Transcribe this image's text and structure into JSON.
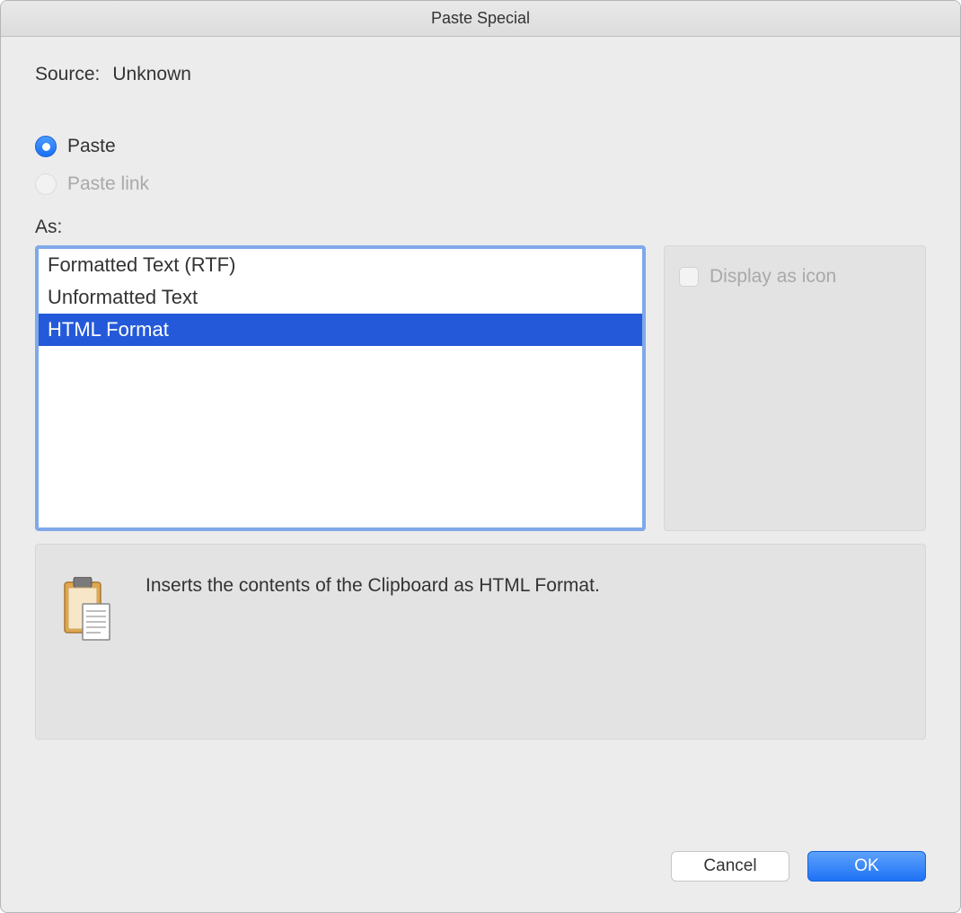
{
  "title": "Paste Special",
  "source": {
    "label": "Source:",
    "value": "Unknown"
  },
  "radios": {
    "paste": {
      "label": "Paste",
      "selected": true,
      "disabled": false
    },
    "pasteLink": {
      "label": "Paste link",
      "selected": false,
      "disabled": true
    }
  },
  "asLabel": "As:",
  "formats": [
    {
      "label": "Formatted Text (RTF)",
      "selected": false
    },
    {
      "label": "Unformatted Text",
      "selected": false
    },
    {
      "label": "HTML Format",
      "selected": true
    }
  ],
  "displayAsIcon": {
    "label": "Display as icon",
    "checked": false,
    "disabled": true
  },
  "description": "Inserts the contents of the Clipboard as HTML Format.",
  "buttons": {
    "cancel": "Cancel",
    "ok": "OK"
  }
}
